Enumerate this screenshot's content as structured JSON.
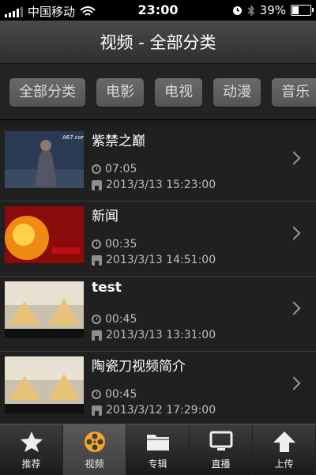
{
  "status": {
    "carrier": "中国移动",
    "time": "23:00",
    "battery": "39%"
  },
  "nav": {
    "title": "视频 - 全部分类"
  },
  "categories": [
    "全部分类",
    "电影",
    "电视",
    "动漫",
    "音乐"
  ],
  "items": [
    {
      "title": "紫禁之巅",
      "duration": "07:05",
      "date": "2013/3/13 15:23:00",
      "thumb_text": "A67.com"
    },
    {
      "title": "新闻",
      "duration": "00:35",
      "date": "2013/3/13 14:51:00"
    },
    {
      "title": "test",
      "duration": "00:45",
      "date": "2013/3/13 13:31:00"
    },
    {
      "title": "陶瓷刀视频简介",
      "duration": "00:45",
      "date": "2013/3/12 17:29:00"
    }
  ],
  "tabs": [
    {
      "label": "推荐",
      "icon": "star-icon"
    },
    {
      "label": "视频",
      "icon": "film-reel-icon"
    },
    {
      "label": "专辑",
      "icon": "folder-icon"
    },
    {
      "label": "直播",
      "icon": "monitor-icon"
    },
    {
      "label": "上传",
      "icon": "upload-arrow-icon"
    }
  ],
  "active_tab": "视频",
  "colors": {
    "accent_active_icon": "#f5a623",
    "background": "#1c1c1c"
  }
}
